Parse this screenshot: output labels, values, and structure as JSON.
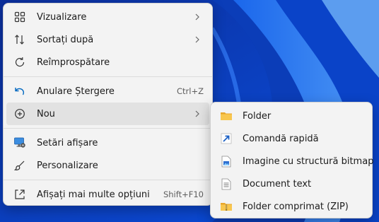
{
  "main_menu": {
    "items": [
      {
        "label": "Vizualizare",
        "icon": "grid-view-icon",
        "has_submenu": true
      },
      {
        "label": "Sortați după",
        "icon": "sort-icon",
        "has_submenu": true
      },
      {
        "label": "Reîmprospătare",
        "icon": "refresh-icon"
      },
      {
        "label": "Anulare Ștergere",
        "icon": "undo-icon",
        "shortcut": "Ctrl+Z"
      },
      {
        "label": "Nou",
        "icon": "new-plus-icon",
        "has_submenu": true
      },
      {
        "label": "Setări afișare",
        "icon": "display-settings-icon"
      },
      {
        "label": "Personalizare",
        "icon": "brush-icon"
      },
      {
        "label": "Afișați mai multe opțiuni",
        "icon": "more-options-icon",
        "shortcut": "Shift+F10"
      }
    ]
  },
  "sub_menu": {
    "items": [
      {
        "label": "Folder",
        "icon": "folder-icon"
      },
      {
        "label": "Comandă rapidă",
        "icon": "shortcut-arrow-icon"
      },
      {
        "label": "Imagine cu structură bitmap",
        "icon": "bitmap-file-icon"
      },
      {
        "label": "Document text",
        "icon": "text-document-icon"
      },
      {
        "label": "Folder comprimat (ZIP)",
        "icon": "zip-folder-icon"
      }
    ]
  },
  "colors": {
    "wallpaper": "#0a4fe0",
    "menu_bg": "#f3f3f3",
    "hover_bg": "#e2e2e2",
    "folder": "#f4c14a",
    "accent": "#0067c0"
  }
}
